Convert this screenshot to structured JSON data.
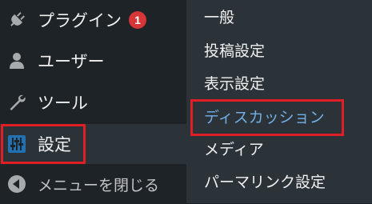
{
  "sidebar": {
    "items": [
      {
        "label": "プラグイン",
        "icon": "plug-icon",
        "badge": "1"
      },
      {
        "label": "ユーザー",
        "icon": "user-icon"
      },
      {
        "label": "ツール",
        "icon": "wrench-icon"
      },
      {
        "label": "設定",
        "icon": "sliders-icon",
        "current": true
      },
      {
        "label": "メニューを閉じる",
        "icon": "collapse-icon"
      }
    ]
  },
  "submenu": {
    "items": [
      {
        "label": "一般"
      },
      {
        "label": "投稿設定"
      },
      {
        "label": "表示設定"
      },
      {
        "label": "ディスカッション",
        "active": true
      },
      {
        "label": "メディア"
      },
      {
        "label": "パーマリンク設定"
      }
    ]
  },
  "colors": {
    "sidebar_bg": "#1d2327",
    "submenu_bg": "#2c3338",
    "accent_blue": "#72aee6",
    "settings_icon_blue": "#2271b1",
    "badge_red": "#d63638",
    "highlight_box": "#e01e26"
  }
}
